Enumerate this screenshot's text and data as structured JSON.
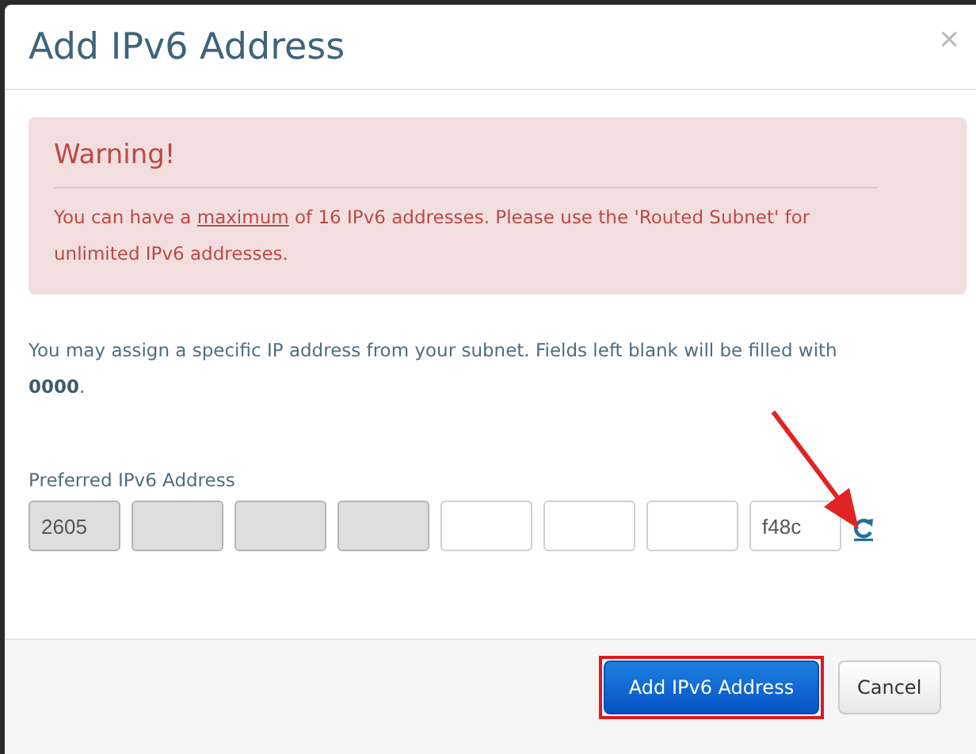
{
  "dialog": {
    "title": "Add IPv6 Address",
    "close": "×"
  },
  "alert": {
    "heading": "Warning!",
    "message": "You can have a **maximum** of 16 IPv6 addresses. Please use the 'Routed Subnet' for unlimited IPv6 addresses."
  },
  "intro": "You may assign a specific IP address from your subnet. Fields left blank will be filled with **0000**.",
  "address": {
    "label": "Preferred IPv6 Address",
    "fields": [
      {
        "value": "2605",
        "disabled": true
      },
      {
        "disabled": true
      },
      {
        "disabled": true
      },
      {
        "disabled": true
      },
      {
        "disabled": false
      },
      {
        "disabled": false
      },
      {
        "disabled": false
      },
      {
        "value": "f48c",
        "disabled": false
      }
    ],
    "refresh_annotated": true
  },
  "buttons": [
    {
      "label": "Add IPv6 Address",
      "kind": "primary",
      "annotated": true
    },
    {
      "label": "Cancel",
      "kind": "default",
      "annotated": false
    }
  ]
}
